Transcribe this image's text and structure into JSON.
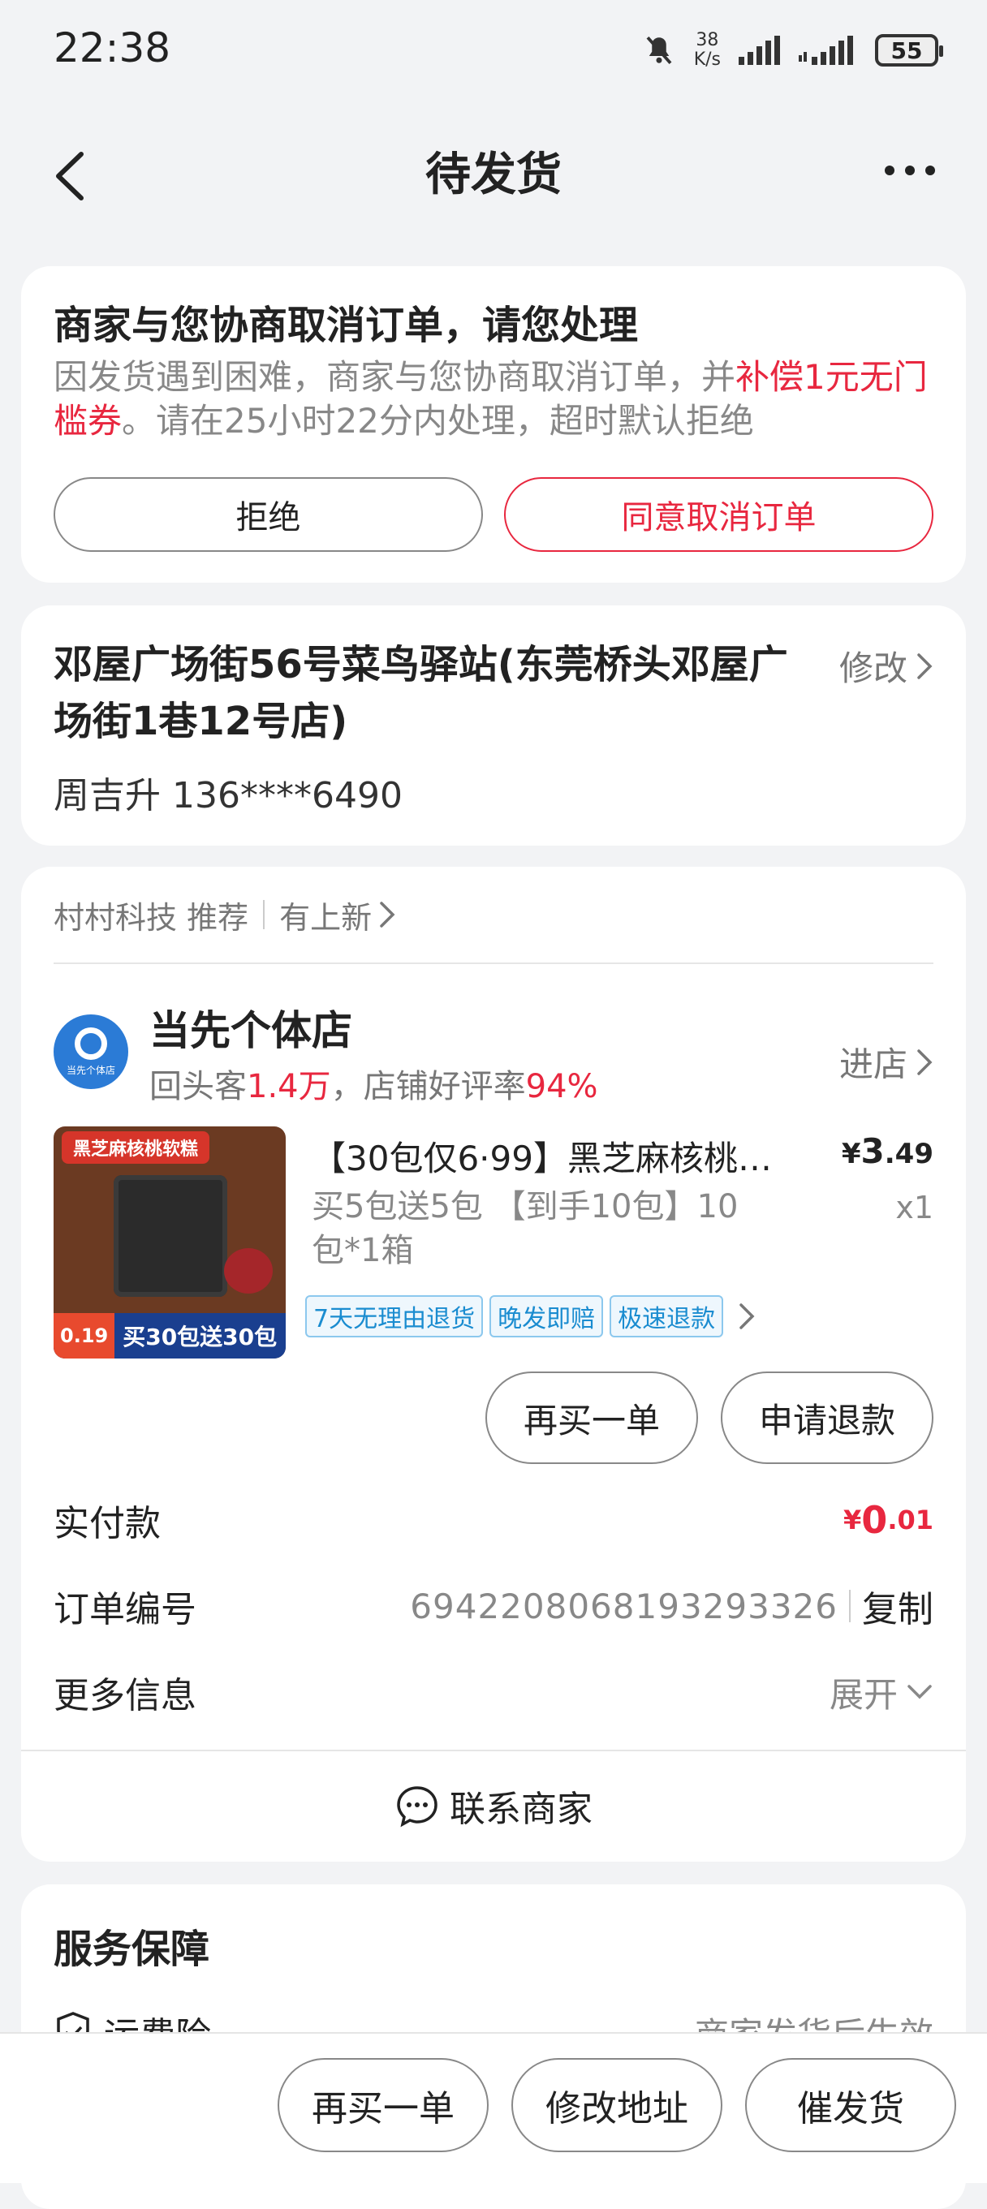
{
  "status": {
    "time": "22:38",
    "speed_value": "38",
    "speed_unit": "K/s",
    "battery": "55"
  },
  "nav": {
    "title": "待发货"
  },
  "cancel_notice": {
    "heading": "商家与您协商取消订单，请您处理",
    "body_part1": "因发货遇到困难，商家与您协商取消订单，并",
    "body_highlight": "补偿1元无门槛券",
    "body_part2": "。请在25小时22分内处理，超时默认拒绝",
    "reject_label": "拒绝",
    "agree_label": "同意取消订单"
  },
  "address": {
    "line": "邓屋广场街56号菜鸟驿站(东莞桥头邓屋广场街1巷12号店)",
    "edit_label": "修改",
    "recipient": "周吉升 136****6490"
  },
  "order": {
    "recommend": {
      "source": "村村科技 推荐",
      "label": "有上新"
    },
    "shop": {
      "logo_text": "当先个体店",
      "name": "当先个体店",
      "stats_prefix": "回头客",
      "repeat_customers": "1.4万",
      "stats_mid": "，店铺好评率",
      "good_rate": "94%",
      "enter_label": "进店"
    },
    "product": {
      "thumb_banner": "黑芝麻核桃软糕",
      "thumb_price": "0.19",
      "thumb_promo": "买30包送30包",
      "title": "【30包仅6·99】黑芝麻核桃…",
      "price_symbol": "¥",
      "price_int": "3",
      "price_dec": ".49",
      "spec": "买5包送5包 【到手10包】10包*1箱",
      "qty": "x1",
      "tags": [
        "7天无理由退货",
        "晚发即赔",
        "极速退款"
      ]
    },
    "buy_again_label": "再买一单",
    "refund_label": "申请退款",
    "paid_label": "实付款",
    "paid": {
      "symbol": "¥",
      "int": "0",
      "dec": ".01"
    },
    "order_no_label": "订单编号",
    "order_no": "6942208068193293326",
    "copy_label": "复制",
    "more_label": "更多信息",
    "expand_label": "展开",
    "contact_label": "联系商家"
  },
  "service": {
    "heading": "服务保障",
    "insurance_label": "运费险",
    "insurance_status": "商家发货后生效"
  },
  "bottom": {
    "buy_again": "再买一单",
    "edit_address": "修改地址",
    "urge": "催发货"
  },
  "colors": {
    "accent": "#e8273f",
    "tag_blue": "#1a8cd0",
    "background": "#f2f3f5"
  }
}
